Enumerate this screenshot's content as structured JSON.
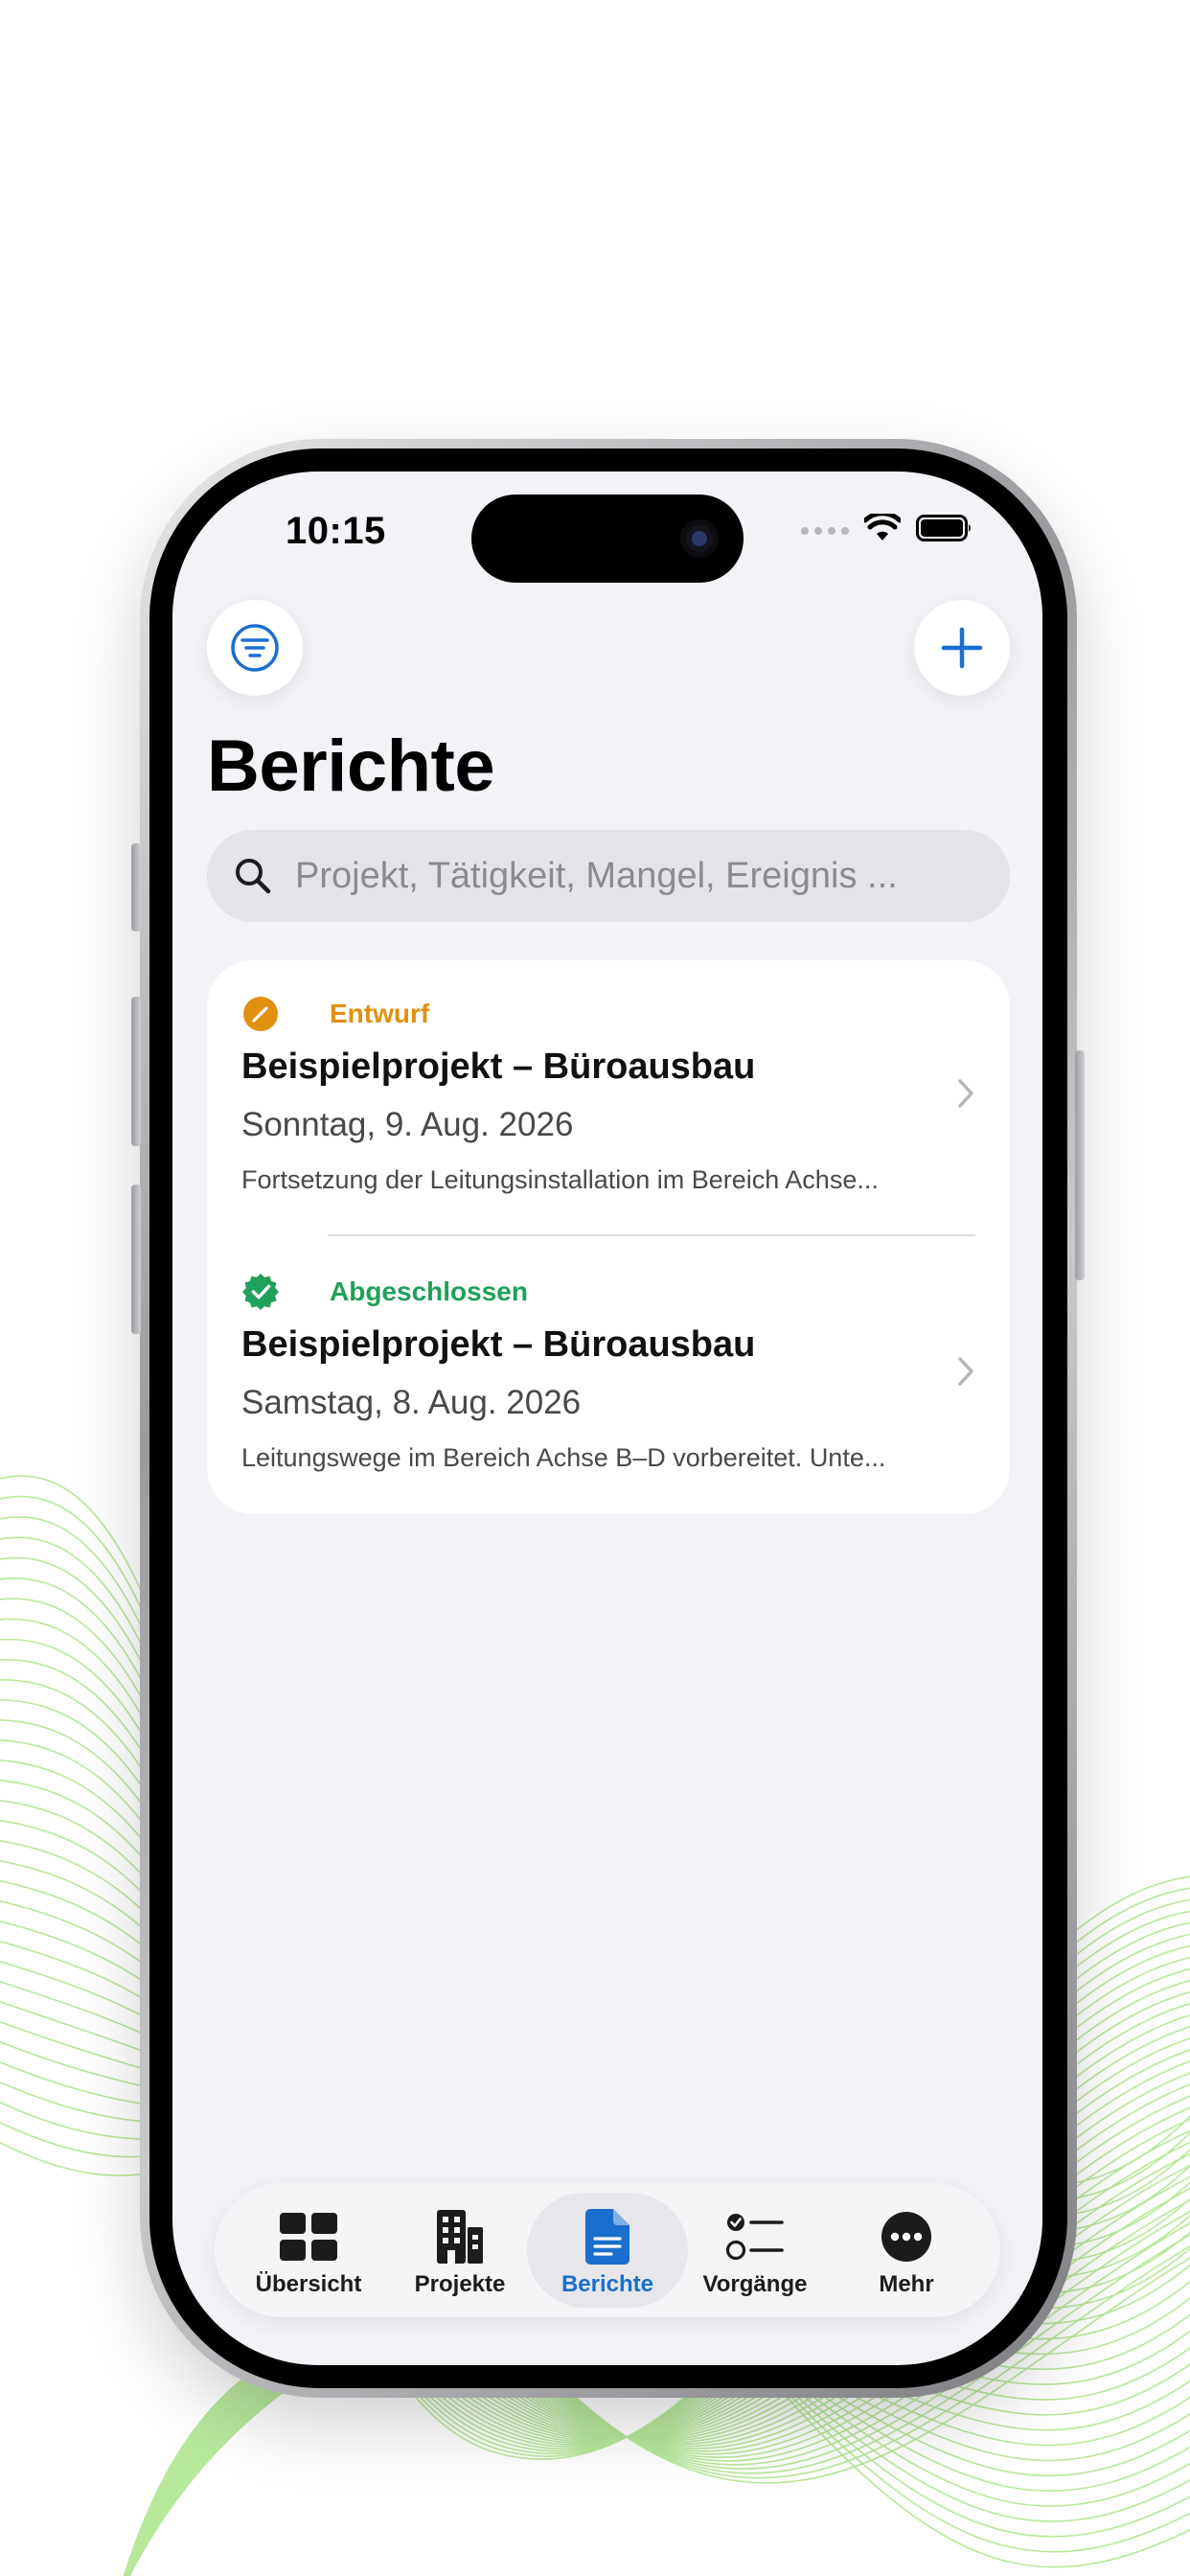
{
  "status_bar": {
    "time": "10:15"
  },
  "header": {
    "title": "Berichte"
  },
  "search": {
    "placeholder": "Projekt, Tätigkeit, Mangel, Ereignis ..."
  },
  "reports": [
    {
      "status": "Entwurf",
      "status_color": "#e0900f",
      "status_icon": "pencil-icon",
      "title": "Beispielprojekt – Büroausbau",
      "date": "Sonntag, 9. Aug. 2026",
      "excerpt": "Fortsetzung der Leitungsinstallation im Bereich Achse..."
    },
    {
      "status": "Abgeschlossen",
      "status_color": "#20a05a",
      "status_icon": "checkmark-seal-icon",
      "title": "Beispielprojekt – Büroausbau",
      "date": "Samstag, 8. Aug. 2026",
      "excerpt": "Leitungswege im Bereich Achse B–D vorbereitet. Unte..."
    }
  ],
  "tabs": [
    {
      "label": "Übersicht",
      "icon": "grid-icon",
      "active": false
    },
    {
      "label": "Projekte",
      "icon": "building-icon",
      "active": false
    },
    {
      "label": "Berichte",
      "icon": "document-icon",
      "active": true
    },
    {
      "label": "Vorgänge",
      "icon": "checklist-icon",
      "active": false
    },
    {
      "label": "Mehr",
      "icon": "more-icon",
      "active": false
    }
  ],
  "colors": {
    "accent": "#1a6fce",
    "background": "#f2f2f7"
  }
}
